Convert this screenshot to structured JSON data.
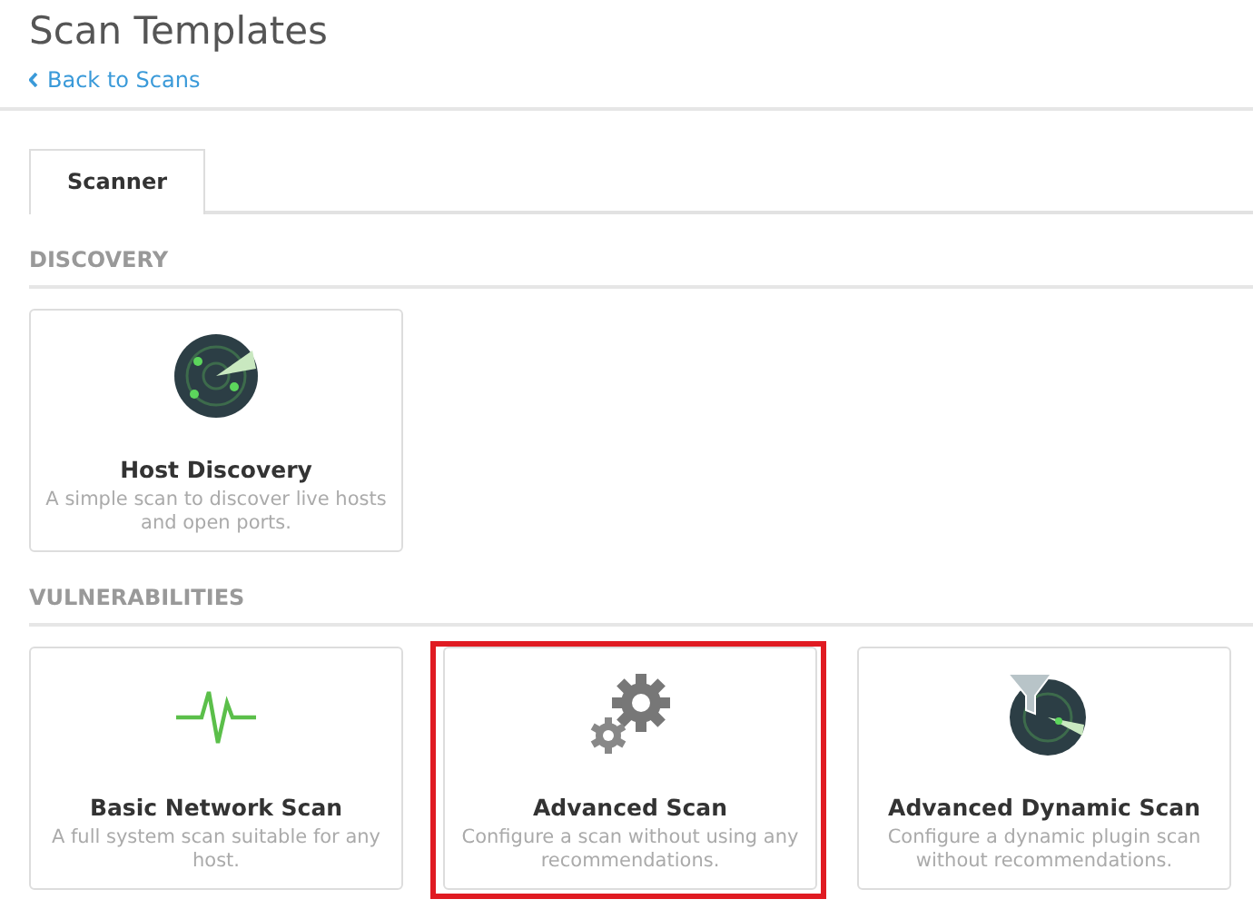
{
  "page": {
    "title": "Scan Templates",
    "back_link": "Back to Scans"
  },
  "tabs": [
    {
      "label": "Scanner",
      "selected": true
    }
  ],
  "sections": [
    {
      "heading": "DISCOVERY",
      "templates": [
        {
          "kind": "radar",
          "title": "Host Discovery",
          "description": "A simple scan to discover live hosts and open ports.",
          "highlighted": false
        }
      ]
    },
    {
      "heading": "VULNERABILITIES",
      "templates": [
        {
          "kind": "pulse",
          "title": "Basic Network Scan",
          "description": "A full system scan suitable for any host.",
          "highlighted": false
        },
        {
          "kind": "gears",
          "title": "Advanced Scan",
          "description": "Configure a scan without using any recommendations.",
          "highlighted": true
        },
        {
          "kind": "radar-filter",
          "title": "Advanced Dynamic Scan",
          "description": "Configure a dynamic plugin scan without recommendations.",
          "highlighted": false
        }
      ]
    }
  ]
}
